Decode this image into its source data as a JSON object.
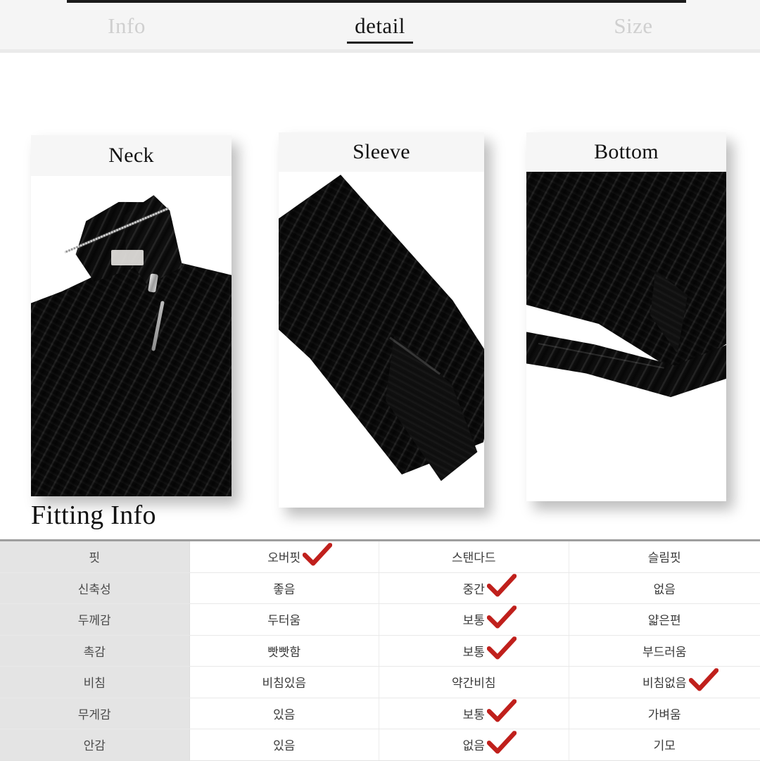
{
  "tabs": [
    {
      "label": "Info",
      "active": false
    },
    {
      "label": "detail",
      "active": true
    },
    {
      "label": "Size",
      "active": false
    }
  ],
  "detail_cards": [
    {
      "title": "Neck",
      "photo": "black-half-zip-knit-collar-photo"
    },
    {
      "title": "Sleeve",
      "photo": "black-knit-sleeve-cuff-photo"
    },
    {
      "title": "Bottom",
      "photo": "black-knit-hem-bottom-photo"
    }
  ],
  "fitting": {
    "heading": "Fitting Info",
    "accent_check_color": "#c0201c",
    "label_column_bg": "#e4e4e4",
    "rows": [
      {
        "label": "핏",
        "options": [
          {
            "text": "오버핏",
            "checked": true
          },
          {
            "text": "스탠다드",
            "checked": false
          },
          {
            "text": "슬림핏",
            "checked": false
          }
        ]
      },
      {
        "label": "신축성",
        "options": [
          {
            "text": "좋음",
            "checked": false
          },
          {
            "text": "중간",
            "checked": true
          },
          {
            "text": "없음",
            "checked": false
          }
        ]
      },
      {
        "label": "두께감",
        "options": [
          {
            "text": "두터움",
            "checked": false
          },
          {
            "text": "보통",
            "checked": true
          },
          {
            "text": "얇은편",
            "checked": false
          }
        ]
      },
      {
        "label": "촉감",
        "options": [
          {
            "text": "빳빳함",
            "checked": false
          },
          {
            "text": "보통",
            "checked": true
          },
          {
            "text": "부드러움",
            "checked": false
          }
        ]
      },
      {
        "label": "비침",
        "options": [
          {
            "text": "비침있음",
            "checked": false
          },
          {
            "text": "약간비침",
            "checked": false
          },
          {
            "text": "비침없음",
            "checked": true
          }
        ]
      },
      {
        "label": "무게감",
        "options": [
          {
            "text": "있음",
            "checked": false
          },
          {
            "text": "보통",
            "checked": true
          },
          {
            "text": "가벼움",
            "checked": false
          }
        ]
      },
      {
        "label": "안감",
        "options": [
          {
            "text": "있음",
            "checked": false
          },
          {
            "text": "없음",
            "checked": true
          },
          {
            "text": "기모",
            "checked": false
          }
        ]
      }
    ]
  }
}
